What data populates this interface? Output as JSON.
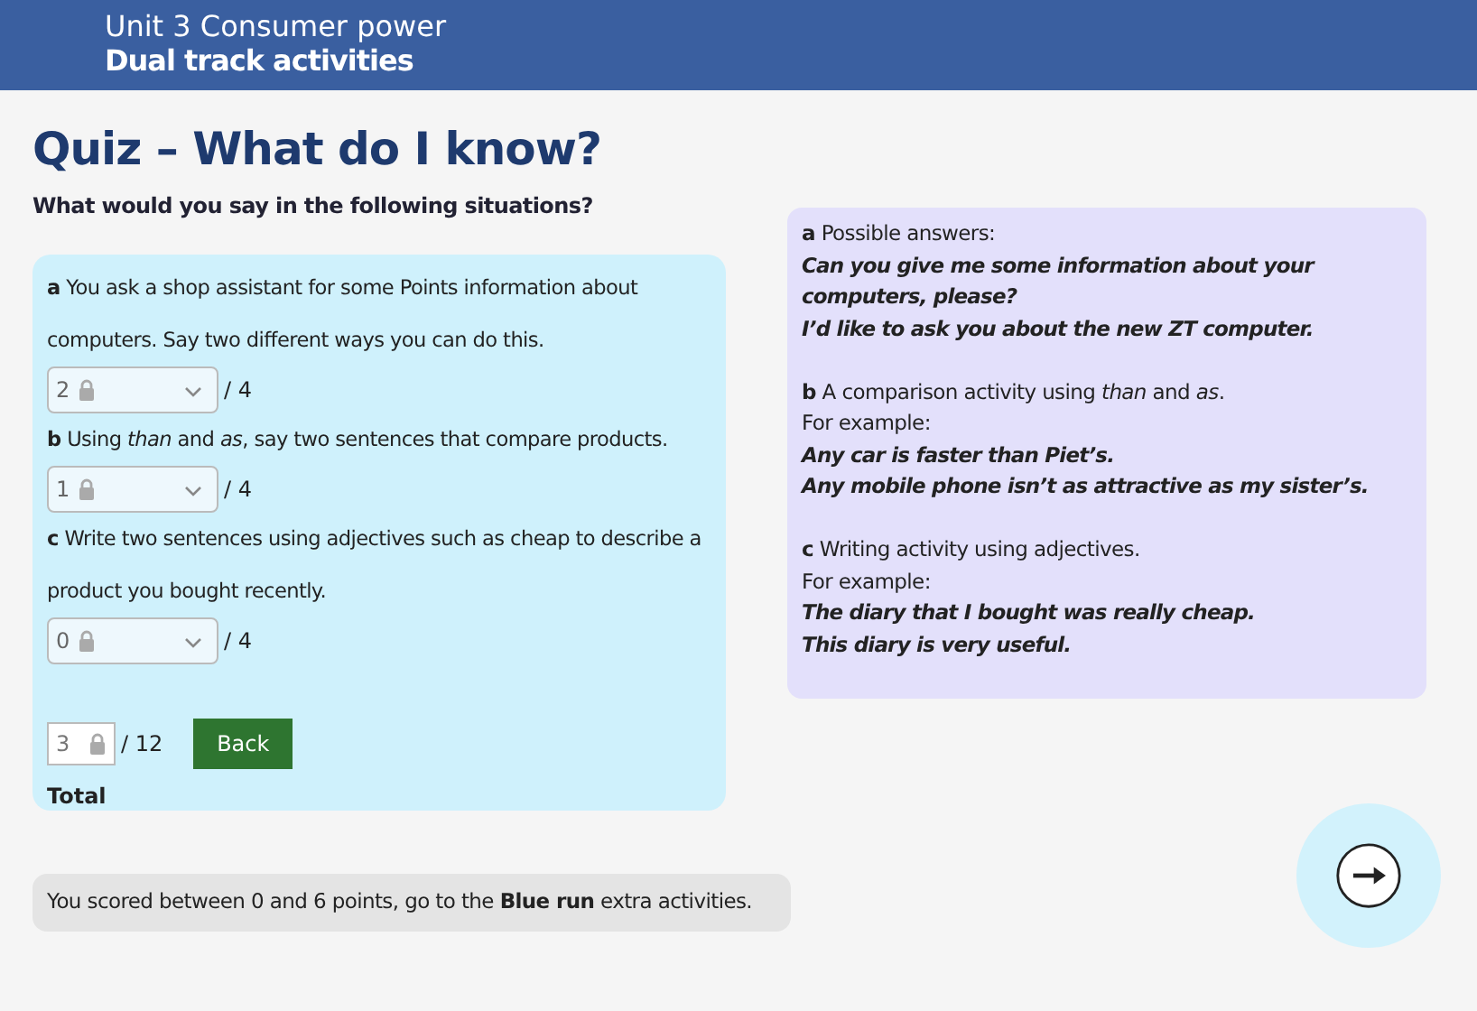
{
  "header": {
    "unit": "Unit 3 Consumer power",
    "subtitle": "Dual track activities"
  },
  "title": "Quiz – What do I know?",
  "instruction": "What would you say in the following situations?",
  "questions": [
    {
      "text": "**a** You ask a shop assistant for some Points information about computers. Say two different ways you can do this.",
      "score": "2",
      "disabled": true,
      "max": "/ 4"
    },
    {
      "text": "**b** Using *than* and *as*, say two sentences that compare products.",
      "score": "1",
      "disabled": true,
      "max": "/ 4"
    },
    {
      "text": "**c** Write two sentences using adjectives such as cheap to describe a product you bought recently.",
      "score": "0",
      "disabled": true,
      "max": "/ 4"
    }
  ],
  "total": {
    "value": "3",
    "disabled": true,
    "max": "/ 12",
    "label": "Total"
  },
  "back_button": "Back",
  "answers": [
    {
      "kind": "intro",
      "text": "**a** Possible answers:"
    },
    {
      "kind": "answer",
      "text": "Can you give me some information about your computers, please?"
    },
    {
      "kind": "answer",
      "text": "I’d like to ask you about the new ZT computer."
    },
    {
      "kind": "gap"
    },
    {
      "kind": "intro",
      "text": "**b** A comparison activity using *than* and *as*."
    },
    {
      "kind": "intro",
      "text": "For example:"
    },
    {
      "kind": "answer",
      "text": "Any car is faster than Piet’s."
    },
    {
      "kind": "answer",
      "text": "Any mobile phone isn’t as attractive as my sister’s."
    },
    {
      "kind": "gap"
    },
    {
      "kind": "intro",
      "text": "**c** Writing activity using adjectives."
    },
    {
      "kind": "intro",
      "text": "For example:"
    },
    {
      "kind": "answer",
      "text": "The diary that I bought was really cheap."
    },
    {
      "kind": "answer",
      "text": "This diary is very useful."
    }
  ],
  "result": "You scored between 0 and 6 points, go to the **Blue run** extra activities."
}
